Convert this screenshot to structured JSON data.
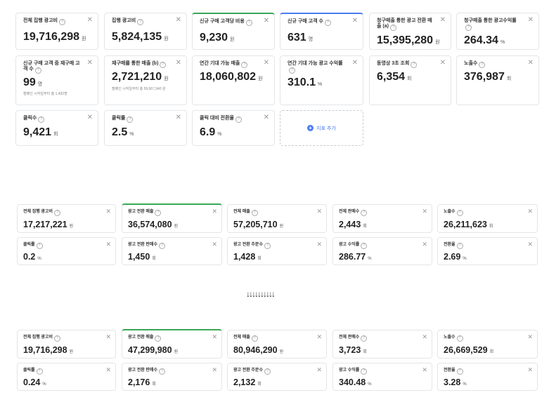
{
  "section1": {
    "cards": [
      {
        "label": "전체 집행 광고비",
        "value": "19,716,298",
        "unit": "원"
      },
      {
        "label": "집행 광고비",
        "value": "5,824,135",
        "unit": "원"
      },
      {
        "label": "신규 구매 고객당 비용",
        "value": "9,230",
        "unit": "원"
      },
      {
        "label": "신규 구매 고객 수",
        "value": "631",
        "unit": "명"
      },
      {
        "label": "청구매출 통한 광고 전환 매출 (a)",
        "value": "15,395,280",
        "unit": "원"
      },
      {
        "label": "청구매출 통한 광고수익률",
        "value": "264.34",
        "unit": "%"
      },
      {
        "label": "신규 구매 고객 중 재구매 고객 수",
        "value": "99",
        "unit": "명",
        "sub": "캠페인 시작일부터 총 1,492명"
      },
      {
        "label": "재구매를 통한 매출 (b)",
        "value": "2,721,210",
        "unit": "원",
        "sub": "캠페인 시작일부터 총 59,667,940 원"
      },
      {
        "label": "연간 기대 가능 매출",
        "value": "18,060,802",
        "unit": "원"
      },
      {
        "label": "연간 기대 가능 광고 수익률",
        "value": "310.1",
        "unit": "%"
      },
      {
        "label": "동영상 3초 조회",
        "value": "6,354",
        "unit": "회"
      },
      {
        "label": "노출수",
        "value": "376,987",
        "unit": "회"
      },
      {
        "label": "클릭수",
        "value": "9,421",
        "unit": "회"
      },
      {
        "label": "클릭률",
        "value": "2.5",
        "unit": "%"
      },
      {
        "label": "클릭 대비 전환율",
        "value": "6.9",
        "unit": "%"
      }
    ],
    "add_label": "지표 추가"
  },
  "section2": {
    "cards": [
      {
        "label": "전체 집행 광고비",
        "value": "17,217,221",
        "unit": "원"
      },
      {
        "label": "광고 전환 매출",
        "value": "36,574,080",
        "unit": "원"
      },
      {
        "label": "전체 매출",
        "value": "57,205,710",
        "unit": "원"
      },
      {
        "label": "전체 판매수",
        "value": "2,443",
        "unit": "회"
      },
      {
        "label": "노출수",
        "value": "26,211,623",
        "unit": "회"
      },
      {
        "label": "클릭률",
        "value": "0.2",
        "unit": "%"
      },
      {
        "label": "광고 전환 판매수",
        "value": "1,450",
        "unit": "회"
      },
      {
        "label": "광고 전환 주문수",
        "value": "1,428",
        "unit": "회"
      },
      {
        "label": "광고 수익률",
        "value": "286.77",
        "unit": "%"
      },
      {
        "label": "전환율",
        "value": "2.69",
        "unit": "%"
      }
    ]
  },
  "arrows": "↓↓↓↓↓↓↓↓↓↓",
  "section3": {
    "cards": [
      {
        "label": "전체 집행 광고비",
        "value": "19,716,298",
        "unit": "원"
      },
      {
        "label": "광고 전환 매출",
        "value": "47,299,980",
        "unit": "원"
      },
      {
        "label": "전체 매출",
        "value": "80,946,290",
        "unit": "원"
      },
      {
        "label": "전체 판매수",
        "value": "3,723",
        "unit": "회"
      },
      {
        "label": "노출수",
        "value": "26,669,529",
        "unit": "회"
      },
      {
        "label": "클릭률",
        "value": "0.24",
        "unit": "%"
      },
      {
        "label": "광고 전환 판매수",
        "value": "2,176",
        "unit": "회"
      },
      {
        "label": "광고 전환 주문수",
        "value": "2,132",
        "unit": "회"
      },
      {
        "label": "광고 수익률",
        "value": "340.48",
        "unit": "%"
      },
      {
        "label": "전환율",
        "value": "3.28",
        "unit": "%"
      }
    ]
  },
  "icons": {
    "help": "question-circle-icon",
    "close": "close-icon",
    "add": "plus-circle-icon",
    "down": "arrow-down-icon"
  },
  "colors": {
    "accent_green": "#3aa757",
    "accent_blue": "#4a7cf5"
  }
}
